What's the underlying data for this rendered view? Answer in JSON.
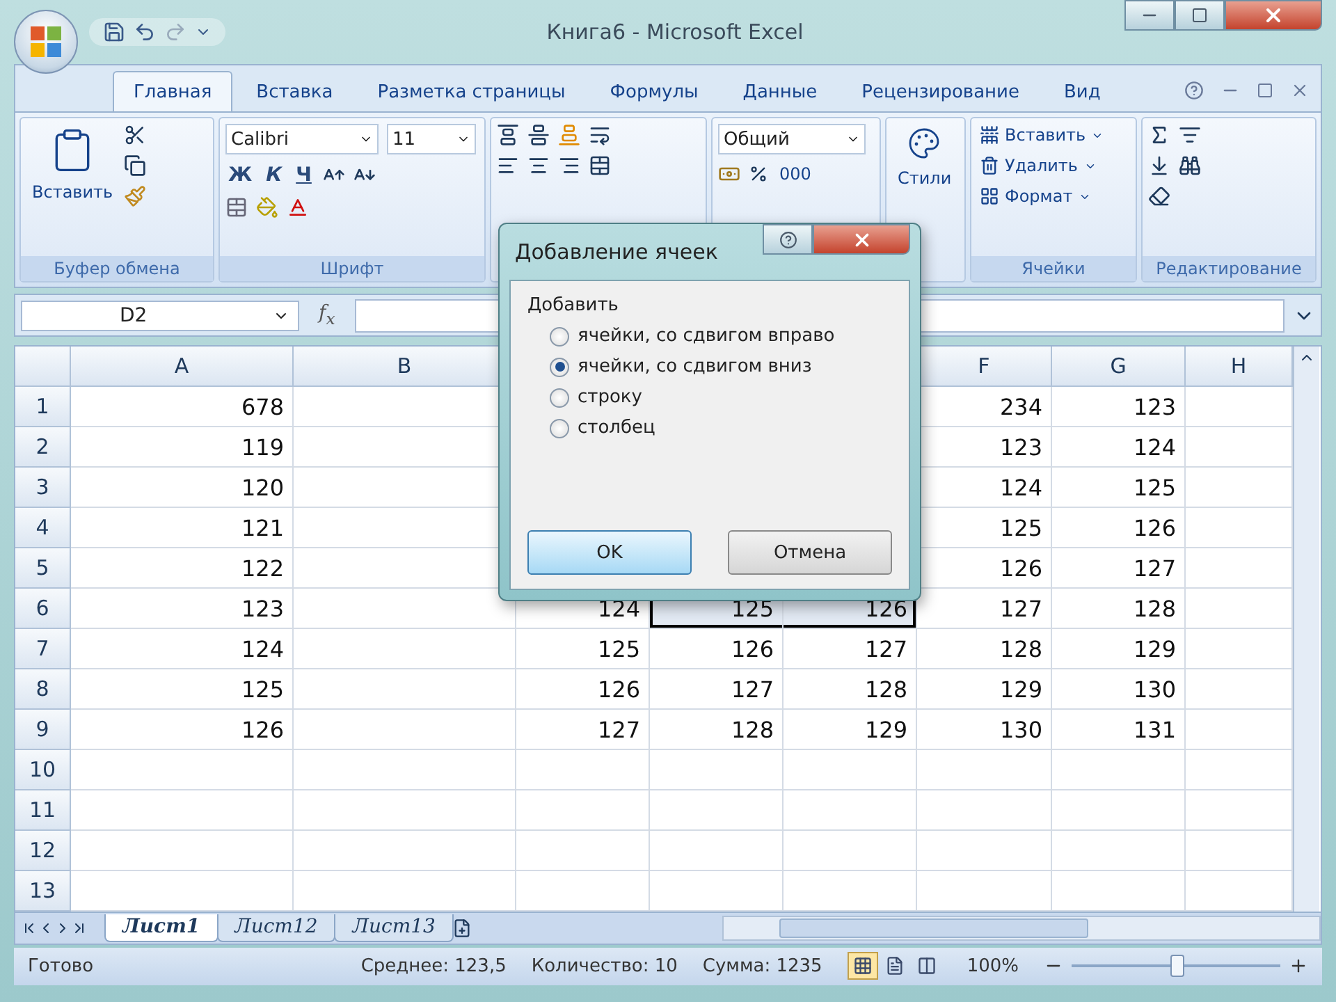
{
  "window": {
    "title": "Книга6 - Microsoft Excel"
  },
  "tabs": [
    {
      "label": "Главная",
      "selected": true
    },
    {
      "label": "Вставка",
      "selected": false
    },
    {
      "label": "Разметка страницы",
      "selected": false
    },
    {
      "label": "Формулы",
      "selected": false
    },
    {
      "label": "Данные",
      "selected": false
    },
    {
      "label": "Рецензирование",
      "selected": false
    },
    {
      "label": "Вид",
      "selected": false
    }
  ],
  "ribbon": {
    "clipboard": {
      "label": "Буфер обмена",
      "paste": "Вставить"
    },
    "font": {
      "label": "Шрифт",
      "name": "Calibri",
      "size": "11",
      "bold": "Ж",
      "italic": "К",
      "underline": "Ч"
    },
    "number": {
      "format": "Общий",
      "thousands": "000"
    },
    "styles": {
      "label": "Стили"
    },
    "cells": {
      "label": "Ячейки",
      "items": [
        {
          "kind": "insert",
          "label": "Вставить"
        },
        {
          "kind": "delete",
          "label": "Удалить"
        },
        {
          "kind": "format",
          "label": "Формат"
        }
      ]
    },
    "editing": {
      "label": "Редактирование"
    }
  },
  "formula_bar": {
    "name_box": "D2",
    "function_label": "f$_{x}$"
  },
  "columns": [
    "A",
    "B",
    null,
    null,
    null,
    "F",
    "G",
    "H"
  ],
  "rows": [
    {
      "header": "1",
      "cells": [
        {
          "text": "678",
          "selected": false
        },
        {
          "selected": false
        },
        null,
        null,
        null,
        {
          "text": "234",
          "selected": false
        },
        {
          "text": "123",
          "selected": false
        },
        {
          "selected": false
        }
      ]
    },
    {
      "header": "2",
      "cells": [
        {
          "text": "119",
          "selected": false
        },
        {
          "selected": false
        },
        null,
        null,
        null,
        {
          "text": "123",
          "selected": false
        },
        {
          "text": "124",
          "selected": false
        },
        {
          "selected": false
        }
      ]
    },
    {
      "header": "3",
      "cells": [
        {
          "text": "120",
          "selected": false
        },
        {
          "selected": false
        },
        null,
        null,
        null,
        {
          "text": "124",
          "selected": false
        },
        {
          "text": "125",
          "selected": false
        },
        {
          "selected": false
        }
      ]
    },
    {
      "header": "4",
      "cells": [
        {
          "text": "121",
          "selected": false
        },
        {
          "selected": false
        },
        null,
        null,
        null,
        {
          "text": "125",
          "selected": false
        },
        {
          "text": "126",
          "selected": false
        },
        {
          "selected": false
        }
      ]
    },
    {
      "header": "5",
      "cells": [
        {
          "text": "122",
          "selected": false
        },
        {
          "selected": false
        },
        null,
        null,
        null,
        {
          "text": "126",
          "selected": false
        },
        {
          "text": "127",
          "selected": false
        },
        {
          "selected": false
        }
      ]
    },
    {
      "header": "6",
      "cells": [
        {
          "text": "123",
          "selected": false
        },
        {
          "selected": false
        },
        {
          "text": "124",
          "selected": false
        },
        {
          "text": "125",
          "selected": true
        },
        {
          "text": "126",
          "selected": true
        },
        {
          "text": "127",
          "selected": false
        },
        {
          "text": "128",
          "selected": false
        },
        {
          "selected": false
        }
      ]
    },
    {
      "header": "7",
      "cells": [
        {
          "text": "124",
          "selected": false
        },
        {
          "selected": false
        },
        {
          "text": "125",
          "selected": false
        },
        {
          "text": "126",
          "selected": false
        },
        {
          "text": "127",
          "selected": false
        },
        {
          "text": "128",
          "selected": false
        },
        {
          "text": "129",
          "selected": false
        },
        {
          "selected": false
        }
      ]
    },
    {
      "header": "8",
      "cells": [
        {
          "text": "125",
          "selected": false
        },
        {
          "selected": false
        },
        {
          "text": "126",
          "selected": false
        },
        {
          "text": "127",
          "selected": false
        },
        {
          "text": "128",
          "selected": false
        },
        {
          "text": "129",
          "selected": false
        },
        {
          "text": "130",
          "selected": false
        },
        {
          "selected": false
        }
      ]
    },
    {
      "header": "9",
      "cells": [
        {
          "text": "126",
          "selected": false
        },
        {
          "selected": false
        },
        {
          "text": "127",
          "selected": false
        },
        {
          "text": "128",
          "selected": false
        },
        {
          "text": "129",
          "selected": false
        },
        {
          "text": "130",
          "selected": false
        },
        {
          "text": "131",
          "selected": false
        },
        {
          "selected": false
        }
      ]
    },
    {
      "header": "10"
    },
    {
      "header": "11"
    },
    {
      "header": "12"
    },
    {
      "header": "13"
    }
  ],
  "sheet_tabs": [
    {
      "label": "Лист1",
      "selected": true
    },
    {
      "label": "Лист12",
      "selected": false
    },
    {
      "label": "Лист13",
      "selected": false
    }
  ],
  "status_bar": {
    "state": "Готово",
    "average": "Среднее: 123,5",
    "count": "Количество: 10",
    "sum": "Сумма: 1235",
    "views": [
      {
        "kind": "normal",
        "selected": true
      },
      {
        "kind": "layout",
        "selected": false
      },
      {
        "kind": "page_break",
        "selected": false
      }
    ],
    "zoom": "100%",
    "zoom_level": {
      "level": 0.5
    }
  },
  "dialog": {
    "title": "Добавление ячеек",
    "group_label": "Добавить",
    "options": [
      {
        "label": "ячейки, со сдвигом вправо",
        "selected": false
      },
      {
        "label": "ячейки, со сдвигом вниз",
        "selected": true
      },
      {
        "label": "строку",
        "selected": false
      },
      {
        "label": "столбец",
        "selected": false
      }
    ],
    "buttons": [
      {
        "label": "OK",
        "kind": "default"
      },
      {
        "label": "Отмена",
        "kind": "normal"
      }
    ]
  }
}
